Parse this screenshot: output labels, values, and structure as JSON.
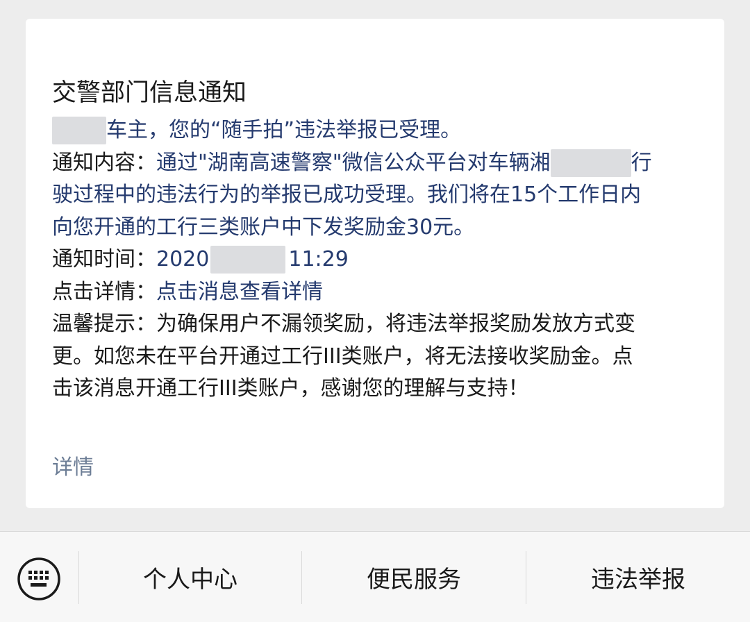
{
  "message": {
    "title": "交警部门信息通知",
    "owner_suffix": "车主，您的“随手拍”违法举报已受理。",
    "content_label": "通知内容：",
    "content_line1_part1": "通过\"湖南高速警察\"微信公众平台对车辆湘",
    "content_line1_part2": "行",
    "content_line2": "驶过程中的违法行为的举报已成功受理。我们将在15个工作日内",
    "content_line3": "向您开通的工行三类账户中下发奖励金30元。",
    "time_label": "通知时间：",
    "time_prefix": "2020",
    "time_suffix": "11:29",
    "detail_label": "点击详情：",
    "detail_value": "点击消息查看详情",
    "tip_label": "温馨提示：",
    "tip_line1": "为确保用户不漏领奖励，将违法举报奖励发放方式变",
    "tip_line2": "更。如您未在平台开通过工行III类账户，将无法接收奖励金。点",
    "tip_line3": "击该消息开通工行III类账户，感谢您的理解与支持！",
    "details_link": "详情"
  },
  "bottom_menu": {
    "keyboard_icon": "keyboard-icon",
    "items": [
      {
        "label": "个人中心"
      },
      {
        "label": "便民服务"
      },
      {
        "label": "违法举报"
      }
    ]
  },
  "colors": {
    "background": "#ededed",
    "card": "#ffffff",
    "value_blue": "#243a6e",
    "link_gray_blue": "#6d7e96"
  }
}
